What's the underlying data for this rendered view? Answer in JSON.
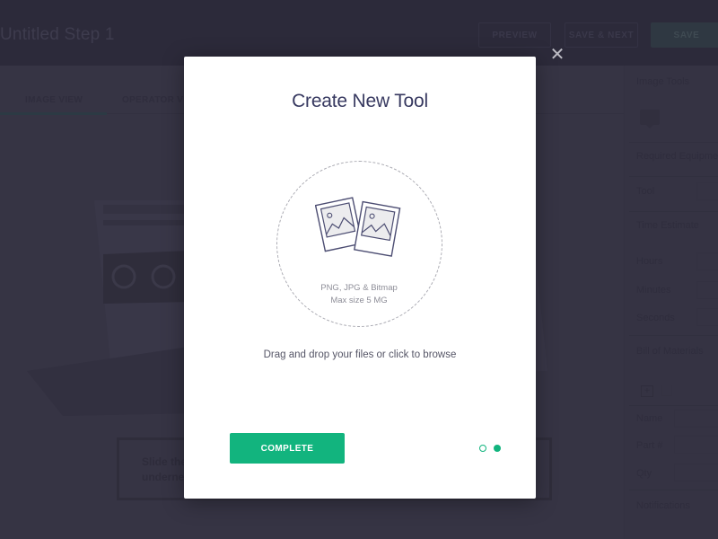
{
  "header": {
    "step_title": "Untitled Step 1",
    "buttons": {
      "preview": "PREVIEW",
      "save_next": "SAVE & NEXT",
      "save": "SAVE"
    }
  },
  "main": {
    "tabs": [
      {
        "label": "IMAGE VIEW",
        "active": true
      },
      {
        "label": "OPERATOR VIEW",
        "active": false
      }
    ],
    "note_text_line1": "Slide the",
    "note_text_line2": "underne"
  },
  "sidebar": {
    "sections": {
      "image_tools": "Image Tools",
      "required_equipment": "Required Equipment",
      "tool": "Tool",
      "time_estimate": "Time Estimate",
      "hours": "Hours",
      "minutes": "Minutes",
      "seconds": "Seconds",
      "bill_of_materials": "Bill of Materials",
      "name": "Name",
      "part": "Part #",
      "qty": "Qty",
      "notifications": "Notifications"
    }
  },
  "modal": {
    "title": "Create New Tool",
    "close_icon": "close-icon",
    "dropzone": {
      "icon": "photos-icon",
      "formats": "PNG, JPG & Bitmap",
      "max_size": "Max size 5 MG"
    },
    "hint": "Drag and drop your files or click to browse",
    "complete_label": "COMPLETE",
    "pagination": {
      "total": 2,
      "current": 2
    },
    "accent_color": "#12b47e"
  }
}
